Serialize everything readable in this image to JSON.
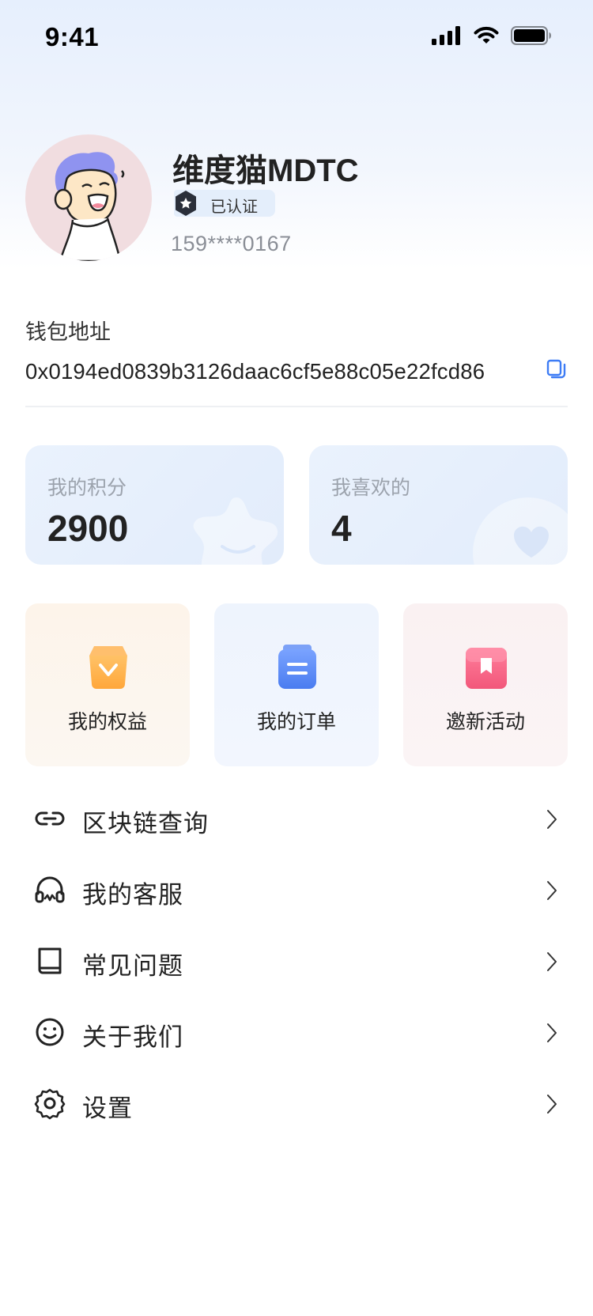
{
  "status_bar": {
    "time": "9:41"
  },
  "profile": {
    "name": "维度猫MDTC",
    "badge": "已认证",
    "phone": "159****0167"
  },
  "wallet": {
    "label": "钱包地址",
    "address": "0x0194ed0839b3126daac6cf5e88c05e22fcd86"
  },
  "stats": [
    {
      "label": "我的积分",
      "value": "2900"
    },
    {
      "label": "我喜欢的",
      "value": "4"
    }
  ],
  "actions": [
    {
      "label": "我的权益",
      "icon": "gift-bag-icon"
    },
    {
      "label": "我的订单",
      "icon": "order-list-icon"
    },
    {
      "label": "邀新活动",
      "icon": "bookmark-icon"
    }
  ],
  "menu": [
    {
      "label": "区块链查询",
      "icon": "link-icon"
    },
    {
      "label": "我的客服",
      "icon": "headset-icon"
    },
    {
      "label": "常见问题",
      "icon": "book-icon"
    },
    {
      "label": "关于我们",
      "icon": "smiley-icon"
    },
    {
      "label": "设置",
      "icon": "gear-icon"
    }
  ],
  "colors": {
    "accent": "#3d7cf5",
    "card_bg": "#e6effc",
    "muted_text": "#9ca3ad"
  }
}
